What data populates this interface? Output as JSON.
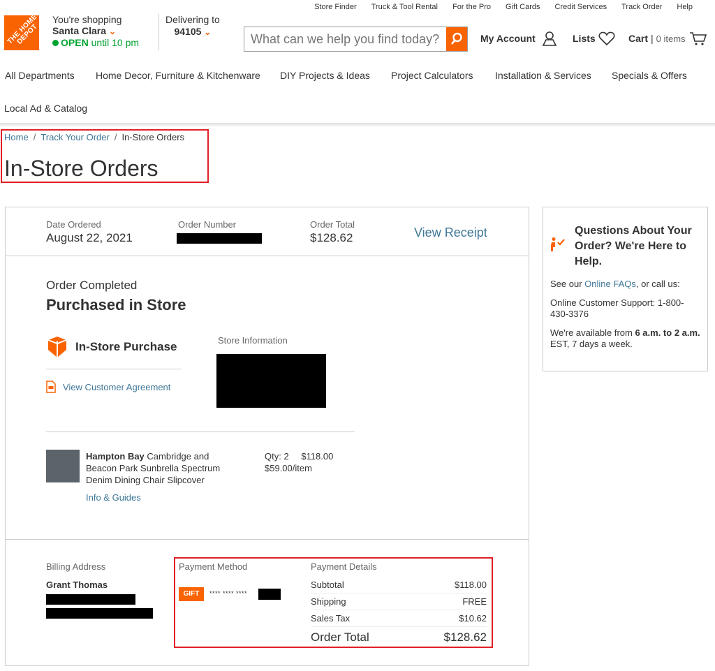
{
  "utility_nav": [
    "Store Finder",
    "Truck & Tool Rental",
    "For the Pro",
    "Gift Cards",
    "Credit Services",
    "Track Order",
    "Help"
  ],
  "logo_text": "THE HOME DEPOT",
  "shopping": {
    "label": "You're shopping",
    "store": "Santa Clara",
    "status": "OPEN",
    "hours": "until 10 pm"
  },
  "delivering": {
    "label": "Delivering to",
    "zip": "94105"
  },
  "search": {
    "placeholder": "What can we help you find today?"
  },
  "header": {
    "account": "My Account",
    "lists": "Lists",
    "cart": "Cart",
    "cart_count": "0 items"
  },
  "main_nav": [
    "All Departments",
    "Home Decor, Furniture & Kitchenware",
    "DIY Projects & Ideas",
    "Project Calculators",
    "Installation & Services",
    "Specials & Offers",
    "Local Ad & Catalog"
  ],
  "breadcrumb": [
    "Home",
    "Track Your Order",
    "In-Store Orders"
  ],
  "page_title": "In-Store Orders",
  "order": {
    "date_label": "Date Ordered",
    "date": "August 22, 2021",
    "number_label": "Order Number",
    "total_label": "Order Total",
    "total": "$128.62",
    "view_receipt": "View Receipt",
    "status": "Order Completed",
    "status_title": "Purchased in Store",
    "purchase_type": "In-Store Purchase",
    "store_info_label": "Store Information",
    "customer_agreement": "View Customer Agreement",
    "item": {
      "brand": "Hampton Bay",
      "name": "Cambridge and Beacon Park Sunbrella Spectrum Denim Dining Chair Slipcover",
      "qty": "Qty: 2",
      "unit_price": "$59.00/item",
      "price": "$118.00",
      "info_link": "Info & Guides"
    },
    "billing_label": "Billing Address",
    "billing_name": "Grant Thomas",
    "payment_method_label": "Payment Method",
    "gift_badge": "GIFT",
    "card_mask": "**** **** ****",
    "payment_details_label": "Payment Details",
    "details": [
      {
        "label": "Subtotal",
        "value": "$118.00"
      },
      {
        "label": "Shipping",
        "value": "FREE"
      },
      {
        "label": "Sales Tax",
        "value": "$10.62"
      }
    ],
    "order_total_label": "Order Total",
    "order_total": "$128.62"
  },
  "help": {
    "title": "Questions About Your Order? We're Here to Help.",
    "faq_prefix": "See our ",
    "faq_link": "Online FAQs",
    "faq_suffix": ", or call us:",
    "support": "Online Customer Support: 1-800-430-3376",
    "hours_prefix": "We're available from ",
    "hours_bold": "6 a.m. to 2 a.m.",
    "hours_suffix": " EST, 7 days a week."
  },
  "colors": {
    "brand": "#f96302",
    "link": "#3e7697",
    "open": "#00a330",
    "highlight": "#e01f26"
  }
}
